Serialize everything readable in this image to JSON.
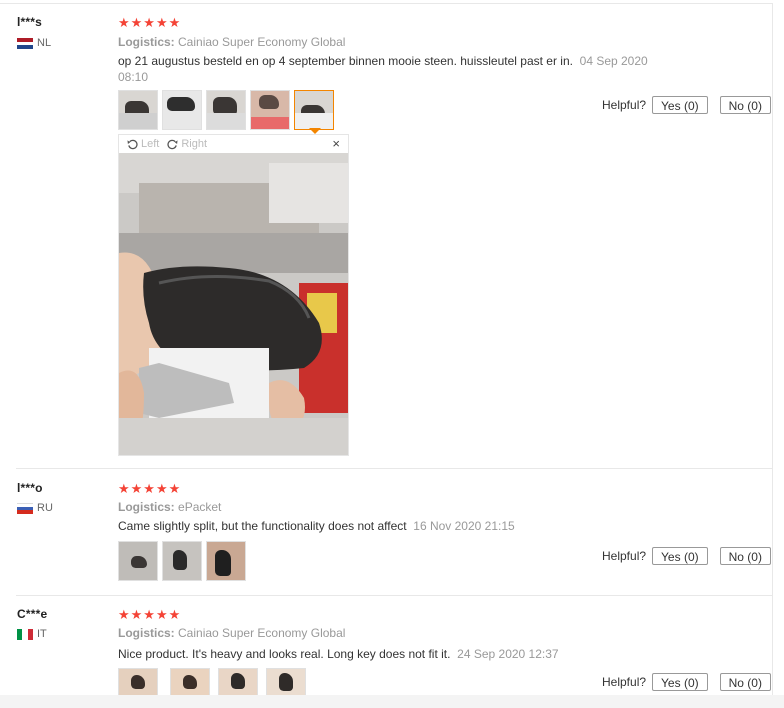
{
  "reviews": [
    {
      "user": "l***s",
      "country": "NL",
      "stars": "★★★★★",
      "logistics_label": "Logistics:",
      "logistics_value": "Cainiao Super Economy Global",
      "text": "op 21 augustus besteld en op 4 september binnen mooie steen. huissleutel past er in.",
      "date": "04 Sep 2020 08:10",
      "helpful_label": "Helpful?",
      "yes_label": "Yes (0)",
      "no_label": "No (0)"
    },
    {
      "user": "l***o",
      "country": "RU",
      "stars": "★★★★★",
      "logistics_label": "Logistics:",
      "logistics_value": "ePacket",
      "text": "Came slightly split, but the functionality does not affect",
      "date": "16 Nov 2020 21:15",
      "helpful_label": "Helpful?",
      "yes_label": "Yes (0)",
      "no_label": "No (0)"
    },
    {
      "user": "C***e",
      "country": "IT",
      "stars": "★★★★★",
      "logistics_label": "Logistics:",
      "logistics_value": "Cainiao Super Economy Global",
      "text": "Nice product. It's heavy and looks real. Long key does not fit it.",
      "date": "24 Sep 2020 12:37",
      "helpful_label": "Helpful?",
      "yes_label": "Yes (0)",
      "no_label": "No (0)"
    }
  ],
  "viewer": {
    "rotate_left": "Left",
    "rotate_right": "Right",
    "close": "×"
  },
  "colors": {
    "star": "#f44336",
    "active_thumb_border": "#f38500",
    "muted_text": "#999999"
  },
  "icons": [
    "rotate-left-icon",
    "rotate-right-icon",
    "close-icon",
    "flag-nl-icon",
    "flag-ru-icon",
    "flag-it-icon"
  ]
}
